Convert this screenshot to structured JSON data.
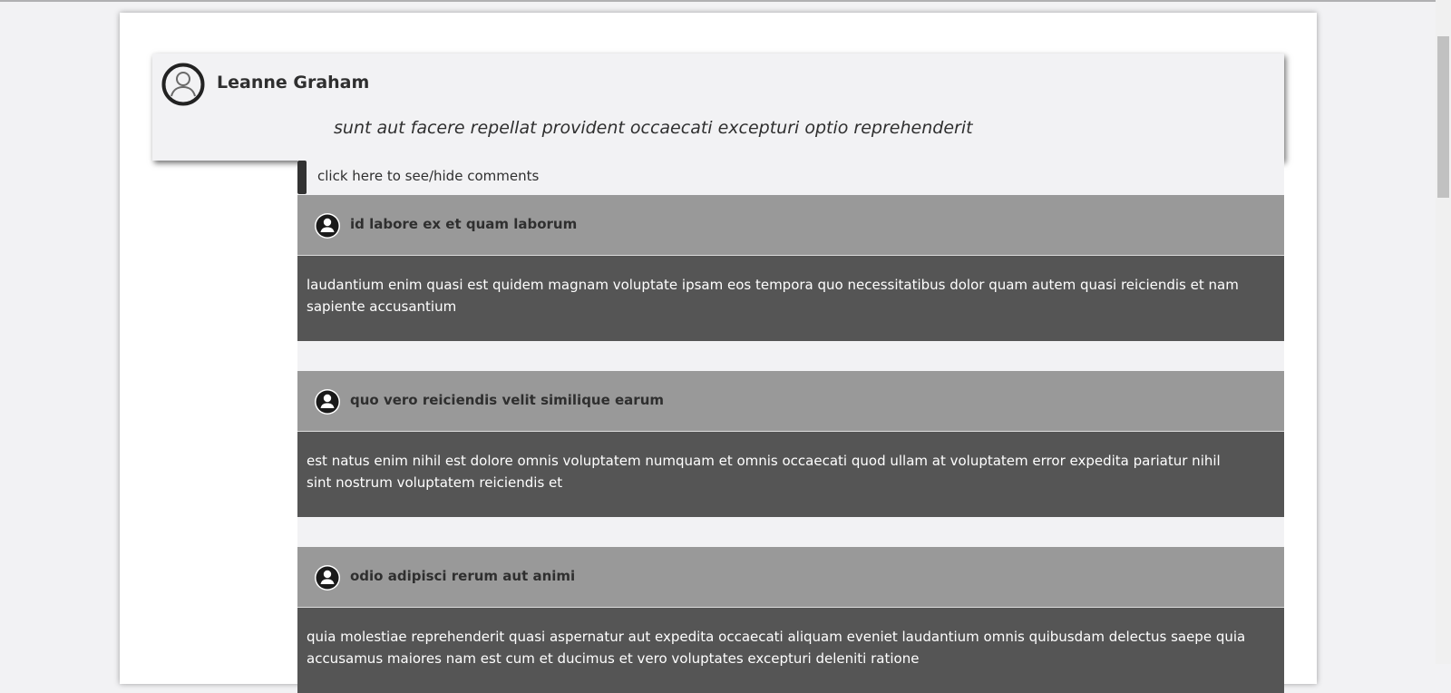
{
  "post": {
    "author": "Leanne Graham",
    "title": "sunt aut facere repellat provident occaecati excepturi optio reprehenderit"
  },
  "comments_toggle": {
    "label": "click here to see/hide comments"
  },
  "comments": [
    {
      "name": "id labore ex et quam laborum",
      "body": "laudantium enim quasi est quidem magnam voluptate ipsam eos tempora quo necessitatibus dolor quam autem quasi reiciendis et nam sapiente accusantium"
    },
    {
      "name": "quo vero reiciendis velit similique earum",
      "body": "est natus enim nihil est dolore omnis voluptatem numquam et omnis occaecati quod ullam at voluptatem error expedita pariatur nihil sint nostrum voluptatem reiciendis et"
    },
    {
      "name": "odio adipisci rerum aut animi",
      "body": "quia molestiae reprehenderit quasi aspernatur aut expedita occaecati aliquam eveniet laudantium omnis quibusdam delectus saepe quia accusamus maiores nam est cum et ducimus et vero voluptates excepturi deleniti ratione"
    }
  ],
  "icons": {
    "author_avatar": "user-circle-outline-icon",
    "comment_avatar": "user-circle-filled-icon"
  },
  "colors": {
    "comment_header": "#999999",
    "comment_body": "#555555",
    "toggle_accent": "#333333"
  }
}
